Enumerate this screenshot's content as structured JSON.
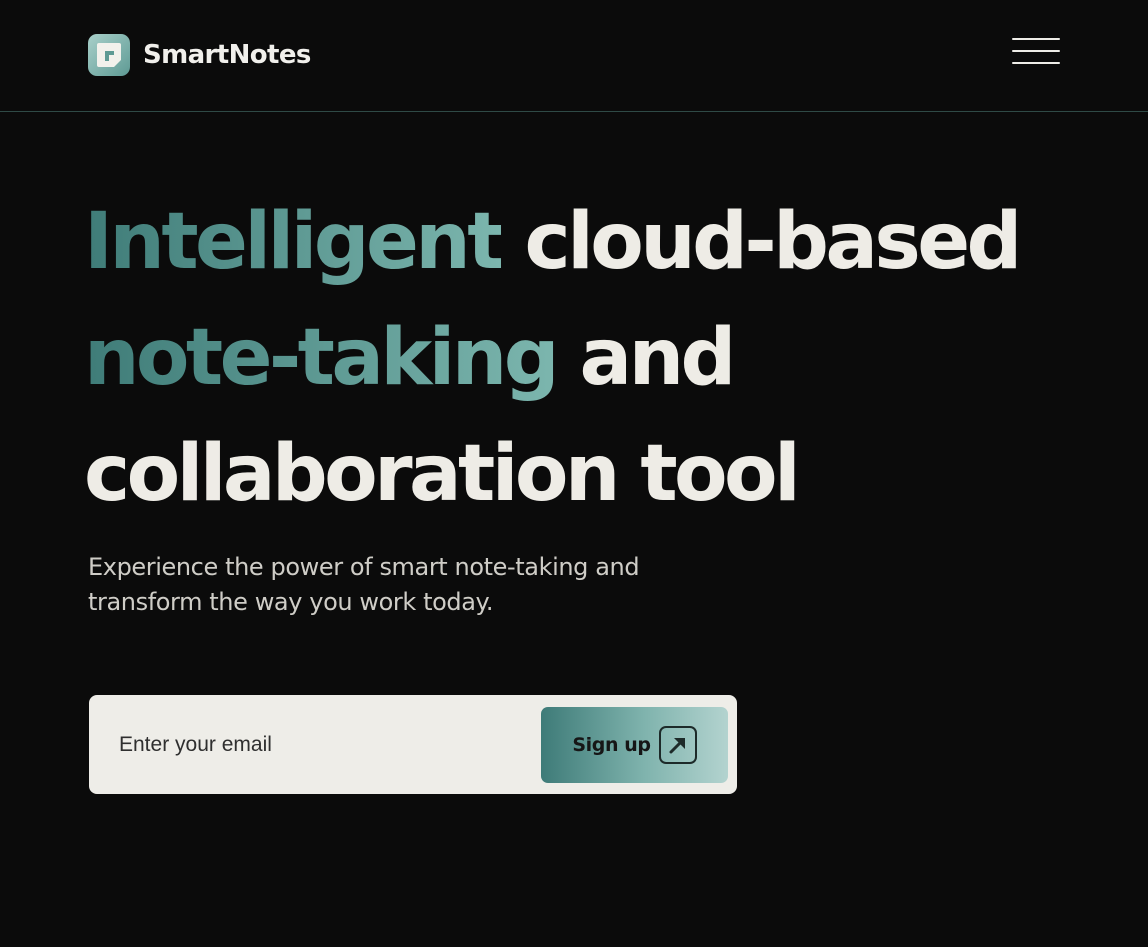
{
  "brand": {
    "name": "SmartNotes",
    "logo_icon": "note-icon",
    "accent_color": "#7cb6ae",
    "accent_dark": "#3f7c78"
  },
  "nav": {
    "menu_icon": "hamburger-menu-icon"
  },
  "hero": {
    "headline": {
      "line1_accent": "Intelligent",
      "line1_rest": " cloud-based",
      "line2_accent": "note-taking",
      "line2_rest": " and",
      "line3": "collaboration tool"
    },
    "subtitle": "Experience the power of smart note-taking and transform the way you work today."
  },
  "signup": {
    "email_placeholder": "Enter your email",
    "email_value": "",
    "button_label": "Sign up",
    "button_icon": "arrow-up-right-icon"
  }
}
